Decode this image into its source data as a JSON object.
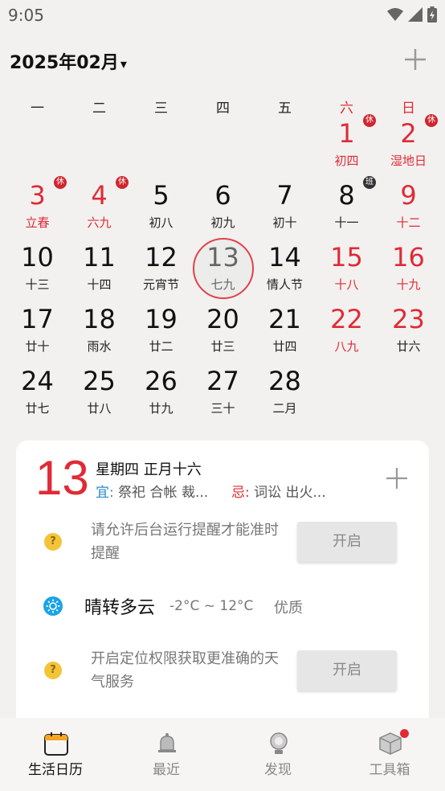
{
  "status_bar": {
    "time": "9:05"
  },
  "header": {
    "month_label": "2025年02月",
    "caret": "▾"
  },
  "weekdays": [
    {
      "label": "一",
      "red": false
    },
    {
      "label": "二",
      "red": false
    },
    {
      "label": "三",
      "red": false
    },
    {
      "label": "四",
      "red": false
    },
    {
      "label": "五",
      "red": false
    },
    {
      "label": "六",
      "red": true
    },
    {
      "label": "日",
      "red": true
    }
  ],
  "days": [
    {
      "day": "1",
      "sub": "初四",
      "red": true,
      "badge": "休",
      "col": 5,
      "row": 0
    },
    {
      "day": "2",
      "sub": "湿地日",
      "red": true,
      "badge": "休",
      "col": 6,
      "row": 0
    },
    {
      "day": "3",
      "sub": "立春",
      "red": true,
      "badge": "休",
      "col": 0,
      "row": 1
    },
    {
      "day": "4",
      "sub": "六九",
      "red": true,
      "badge": "休",
      "col": 1,
      "row": 1
    },
    {
      "day": "5",
      "sub": "初八",
      "red": false,
      "col": 2,
      "row": 1
    },
    {
      "day": "6",
      "sub": "初九",
      "red": false,
      "col": 3,
      "row": 1
    },
    {
      "day": "7",
      "sub": "初十",
      "red": false,
      "col": 4,
      "row": 1
    },
    {
      "day": "8",
      "sub": "十一",
      "red": false,
      "badge": "班",
      "badge_type": "work",
      "col": 5,
      "row": 1
    },
    {
      "day": "9",
      "sub": "十二",
      "red": true,
      "col": 6,
      "row": 1
    },
    {
      "day": "10",
      "sub": "十三",
      "red": false,
      "col": 0,
      "row": 2
    },
    {
      "day": "11",
      "sub": "十四",
      "red": false,
      "col": 1,
      "row": 2
    },
    {
      "day": "12",
      "sub": "元宵节",
      "red": false,
      "col": 2,
      "row": 2
    },
    {
      "day": "13",
      "sub": "七九",
      "red": false,
      "selected": true,
      "col": 3,
      "row": 2
    },
    {
      "day": "14",
      "sub": "情人节",
      "red": false,
      "col": 4,
      "row": 2
    },
    {
      "day": "15",
      "sub": "十八",
      "red": true,
      "col": 5,
      "row": 2
    },
    {
      "day": "16",
      "sub": "十九",
      "red": true,
      "col": 6,
      "row": 2
    },
    {
      "day": "17",
      "sub": "廿十",
      "red": false,
      "col": 0,
      "row": 3
    },
    {
      "day": "18",
      "sub": "雨水",
      "red": false,
      "col": 1,
      "row": 3
    },
    {
      "day": "19",
      "sub": "廿二",
      "red": false,
      "col": 2,
      "row": 3
    },
    {
      "day": "20",
      "sub": "廿三",
      "red": false,
      "col": 3,
      "row": 3
    },
    {
      "day": "21",
      "sub": "廿四",
      "red": false,
      "col": 4,
      "row": 3
    },
    {
      "day": "22",
      "sub": "八九",
      "red": true,
      "col": 5,
      "row": 3
    },
    {
      "day": "23",
      "sub": "廿六",
      "red": true,
      "sub_black": true,
      "col": 6,
      "row": 3
    },
    {
      "day": "24",
      "sub": "廿七",
      "red": false,
      "col": 0,
      "row": 4
    },
    {
      "day": "25",
      "sub": "廿八",
      "red": false,
      "col": 1,
      "row": 4
    },
    {
      "day": "26",
      "sub": "廿九",
      "red": false,
      "col": 2,
      "row": 4
    },
    {
      "day": "27",
      "sub": "三十",
      "red": false,
      "col": 3,
      "row": 4
    },
    {
      "day": "28",
      "sub": "二月",
      "red": false,
      "col": 4,
      "row": 4
    }
  ],
  "card": {
    "day": "13",
    "week_lunar": "星期四 正月十六",
    "yi_label": "宜:",
    "yi_text": "祭祀 合帐 裁...",
    "ji_label": "忌:",
    "ji_text": "词讼 出火...",
    "reminder_text": "请允许后台运行提醒才能准时提醒",
    "reminder_button": "开启",
    "weather_desc": "晴转多云",
    "weather_temp": "-2°C ~ 12°C",
    "weather_aq": "优质",
    "location_text": "开启定位权限获取更准确的天气服务",
    "location_button": "开启",
    "question_mark": "?"
  },
  "bottom_nav": [
    {
      "label": "生活日历",
      "icon": "calendar-icon",
      "active": true
    },
    {
      "label": "最近",
      "icon": "bell-icon",
      "active": false
    },
    {
      "label": "发现",
      "icon": "lightbulb-icon",
      "active": false
    },
    {
      "label": "工具箱",
      "icon": "box-icon",
      "active": false
    }
  ],
  "colors": {
    "accent": "#e02b36",
    "yi": "#2d8bc8"
  }
}
